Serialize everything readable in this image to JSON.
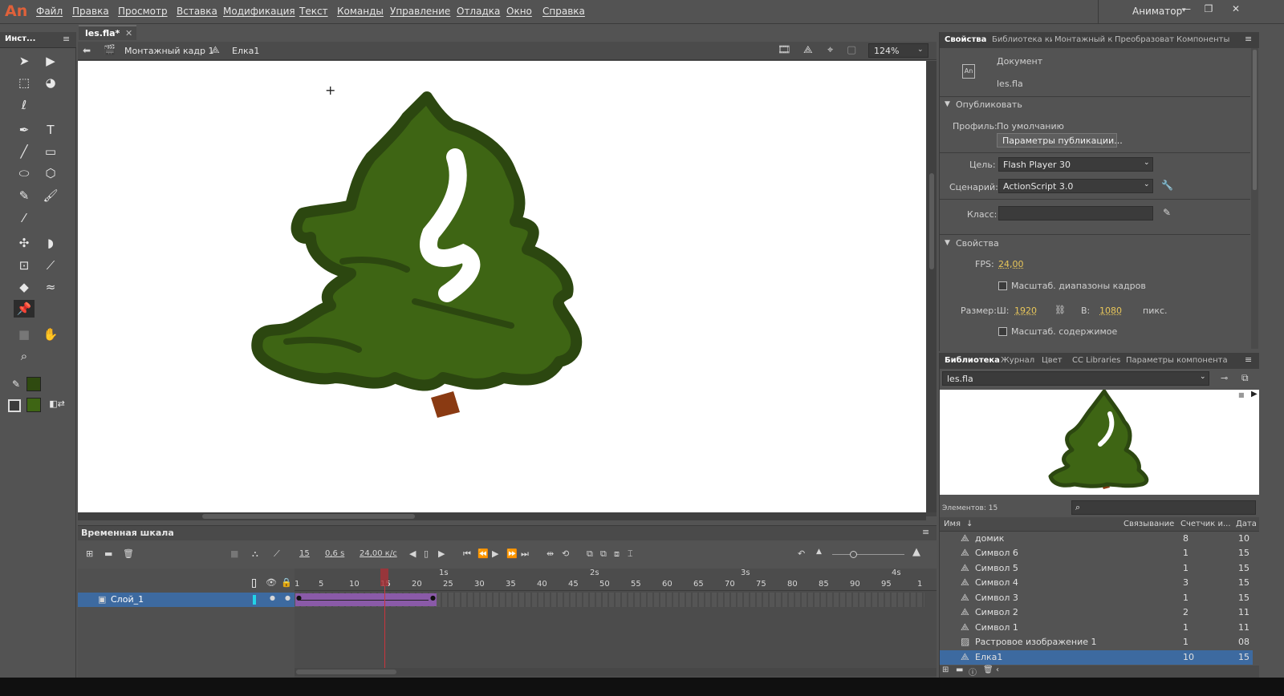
{
  "app": {
    "logo": "An",
    "workspace": "Аниматор",
    "doc_tab": "les.fla*"
  },
  "menu": [
    "Файл",
    "Правка",
    "Просмотр",
    "Вставка",
    "Модификация",
    "Текст",
    "Команды",
    "Управление",
    "Отладка",
    "Окно",
    "Справка"
  ],
  "tools_panel": {
    "title": "Инст..."
  },
  "editbar": {
    "scene": "Монтажный кадр 1",
    "symbol": "Елка1",
    "zoom": "124%"
  },
  "timeline": {
    "title": "Временная шкала",
    "current_frame": "15",
    "time": "0,6 s",
    "fps": "24,00 к/с",
    "layer": "Слой_1",
    "ruler_frames": [
      "1",
      "5",
      "10",
      "15",
      "20",
      "25",
      "30",
      "35",
      "40",
      "45",
      "50",
      "55",
      "60",
      "65",
      "70",
      "75",
      "80",
      "85",
      "90",
      "95",
      "1"
    ],
    "ruler_seconds": [
      "1s",
      "2s",
      "3s",
      "4s"
    ]
  },
  "properties": {
    "tabs": [
      "Свойства",
      "Библиотека ки",
      "Монтажный к",
      "Преобразоват",
      "Компоненты"
    ],
    "doc_type": "Документ",
    "doc_icon": "An",
    "doc_name": "les.fla",
    "publish_section": "Опубликовать",
    "profile_label": "Профиль:",
    "profile_value": "По умолчанию",
    "publish_button": "Параметры публикации...",
    "target_label": "Цель:",
    "target_value": "Flash Player 30",
    "script_label": "Сценарий:",
    "script_value": "ActionScript 3.0",
    "class_label": "Класс:",
    "class_value": "",
    "props_section": "Свойства",
    "fps_label": "FPS:",
    "fps_value": "24,00",
    "scale_frames": "Масштаб. диапазоны кадров",
    "size_label": "Размер:",
    "width_label": "Ш:",
    "width_value": "1920",
    "height_label": "В:",
    "height_value": "1080",
    "unit": "пикс.",
    "scale_content": "Масштаб. содержимое"
  },
  "library": {
    "tabs": [
      "Библиотека",
      "Журнал",
      "Цвет",
      "CC Libraries",
      "Параметры компонента"
    ],
    "selected_file": "les.fla",
    "count_label": "Элементов: 15",
    "columns": [
      "Имя",
      "Связывание",
      "Счетчик и...",
      "Дата"
    ],
    "items": [
      {
        "name": "домик",
        "icon": "symbol-icon",
        "count": "8",
        "date": "10"
      },
      {
        "name": "Символ 6",
        "icon": "symbol-icon",
        "count": "1",
        "date": "15"
      },
      {
        "name": "Символ 5",
        "icon": "symbol-icon",
        "count": "1",
        "date": "15"
      },
      {
        "name": "Символ 4",
        "icon": "symbol-icon",
        "count": "3",
        "date": "15"
      },
      {
        "name": "Символ 3",
        "icon": "symbol-icon",
        "count": "1",
        "date": "15"
      },
      {
        "name": "Символ 2",
        "icon": "symbol-icon",
        "count": "2",
        "date": "11"
      },
      {
        "name": "Символ 1",
        "icon": "symbol-icon",
        "count": "1",
        "date": "11"
      },
      {
        "name": "Растровое изображение 1",
        "icon": "bitmap-icon",
        "count": "1",
        "date": "08"
      },
      {
        "name": "Елка1",
        "icon": "symbol-icon",
        "count": "10",
        "date": "15"
      }
    ]
  },
  "colors": {
    "stroke": "#2f4a10",
    "fill": "#3e6514",
    "tween": "#8a5aa8",
    "selection": "#3d6aa0",
    "accent": "#e0613a"
  }
}
